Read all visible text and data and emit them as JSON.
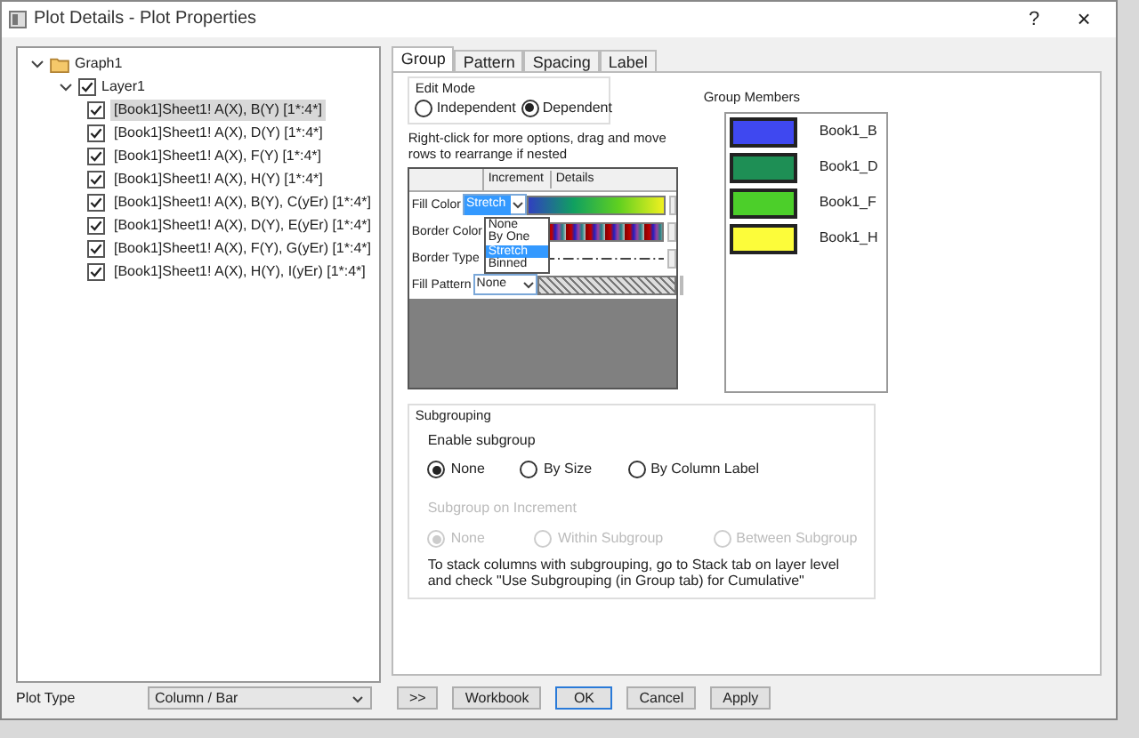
{
  "window": {
    "title": "Plot Details - Plot Properties",
    "help": "?",
    "close": "×"
  },
  "tree": [
    {
      "label": "Graph1",
      "expanded": true,
      "children": [
        {
          "label": "Layer1",
          "checked": true,
          "expanded": true,
          "children": [
            {
              "label": "[Book1]Sheet1! A(X), B(Y) [1*:4*]",
              "checked": true,
              "selected": true
            },
            {
              "label": "[Book1]Sheet1! A(X), D(Y) [1*:4*]",
              "checked": true,
              "selected": false
            },
            {
              "label": "[Book1]Sheet1! A(X), F(Y) [1*:4*]",
              "checked": true,
              "selected": false
            },
            {
              "label": "[Book1]Sheet1! A(X), H(Y) [1*:4*]",
              "checked": true,
              "selected": false
            },
            {
              "label": "[Book1]Sheet1! A(X), B(Y), C(yEr) [1*:4*]",
              "checked": true,
              "selected": false
            },
            {
              "label": "[Book1]Sheet1! A(X), D(Y), E(yEr) [1*:4*]",
              "checked": true,
              "selected": false
            },
            {
              "label": "[Book1]Sheet1! A(X), F(Y), G(yEr) [1*:4*]",
              "checked": true,
              "selected": false
            },
            {
              "label": "[Book1]Sheet1! A(X), H(Y), I(yEr) [1*:4*]",
              "checked": true,
              "selected": false
            }
          ]
        }
      ]
    }
  ],
  "tabs": [
    {
      "label": "Group",
      "selected": true
    },
    {
      "label": "Pattern",
      "selected": false
    },
    {
      "label": "Spacing",
      "selected": false
    },
    {
      "label": "Label",
      "selected": false
    }
  ],
  "edit_mode": {
    "title": "Edit Mode",
    "options": [
      {
        "label": "Independent",
        "selected": false
      },
      {
        "label": "Dependent",
        "selected": true
      }
    ]
  },
  "hint": "Right-click for more options, drag and move rows to  rearrange if nested",
  "table": {
    "columns": [
      "Increment",
      "Details"
    ],
    "rows": [
      {
        "label": "Fill Color",
        "increment": "Stretch",
        "kind": "gradient",
        "dropdown": [
          {
            "label": "None",
            "selected": false
          },
          {
            "label": "By One",
            "selected": false
          },
          {
            "label": "Stretch",
            "selected": true
          },
          {
            "label": "Binned",
            "selected": false
          }
        ]
      },
      {
        "label": "Border Color",
        "increment": "",
        "kind": "palette"
      },
      {
        "label": "Border Type",
        "increment": "",
        "kind": "line"
      },
      {
        "label": "Fill Pattern",
        "increment": "None",
        "kind": "pattern"
      }
    ]
  },
  "group_members": {
    "title": "Group Members",
    "items": [
      {
        "label": "Book1_B",
        "color": "#3f48f0"
      },
      {
        "label": "Book1_D",
        "color": "#1e8f55"
      },
      {
        "label": "Book1_F",
        "color": "#4ccf2a"
      },
      {
        "label": "Book1_H",
        "color": "#fcfc3a"
      }
    ]
  },
  "subgrouping": {
    "title": "Subgrouping",
    "enable_label": "Enable subgroup",
    "enable_options": [
      {
        "label": "None",
        "selected": true
      },
      {
        "label": "By Size",
        "selected": false
      },
      {
        "label": "By Column Label",
        "selected": false
      }
    ],
    "increment_label": "Subgroup on Increment",
    "increment_disabled": true,
    "increment_options": [
      {
        "label": "None",
        "selected": true
      },
      {
        "label": "Within Subgroup",
        "selected": false
      },
      {
        "label": "Between Subgroup",
        "selected": false
      }
    ],
    "note": "To stack columns with subgrouping, go to Stack tab on layer level and check \"Use Subgrouping (in Group tab) for Cumulative\""
  },
  "bottom": {
    "plot_type_label": "Plot Type",
    "plot_type": "Column / Bar",
    "buttons": [
      {
        "label": ">>",
        "default": false
      },
      {
        "label": "Workbook",
        "default": false
      },
      {
        "label": "OK",
        "default": true
      },
      {
        "label": "Cancel",
        "default": false
      },
      {
        "label": "Apply",
        "default": false
      }
    ]
  }
}
